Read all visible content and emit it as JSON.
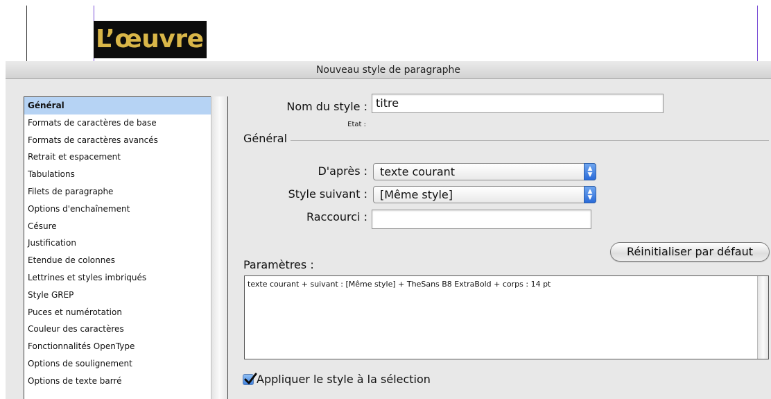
{
  "document": {
    "heading_text": "L’œuvre"
  },
  "dialog": {
    "title": "Nouveau style de paragraphe",
    "categories": [
      "Général",
      "Formats de caractères de base",
      "Formats de caractères avancés",
      "Retrait et espacement",
      "Tabulations",
      "Filets de paragraphe",
      "Options d'enchaînement",
      "Césure",
      "Justification",
      "Etendue de colonnes",
      "Lettrines et styles imbriqués",
      "Style GREP",
      "Puces et numérotation",
      "Couleur des caractères",
      "Fonctionnalités OpenType",
      "Options de soulignement",
      "Options de texte barré"
    ],
    "selected_category": "Général",
    "style_name_label": "Nom du style :",
    "style_name_value": "titre",
    "state_label": "Etat :",
    "section_title": "Général",
    "based_on_label": "D'après :",
    "based_on_value": "texte courant",
    "next_style_label": "Style suivant :",
    "next_style_value": "[Même style]",
    "shortcut_label": "Raccourci :",
    "shortcut_value": "",
    "reset_button": "Réinitialiser par défaut",
    "params_label": "Paramètres :",
    "params_text": "texte courant + suivant : [Même style] + TheSans B8 ExtraBold + corps : 14 pt",
    "apply_checkbox_label": "Appliquer le style à la sélection",
    "apply_checked": true
  },
  "colors": {
    "heading_text": "#d9b648",
    "heading_bg": "#0c0c0c",
    "selection": "#b6d3f4",
    "guide": "#7a4fd6"
  },
  "icons": {
    "popup_arrows": "updown-arrows-icon",
    "checkbox": "checkmark-icon"
  }
}
